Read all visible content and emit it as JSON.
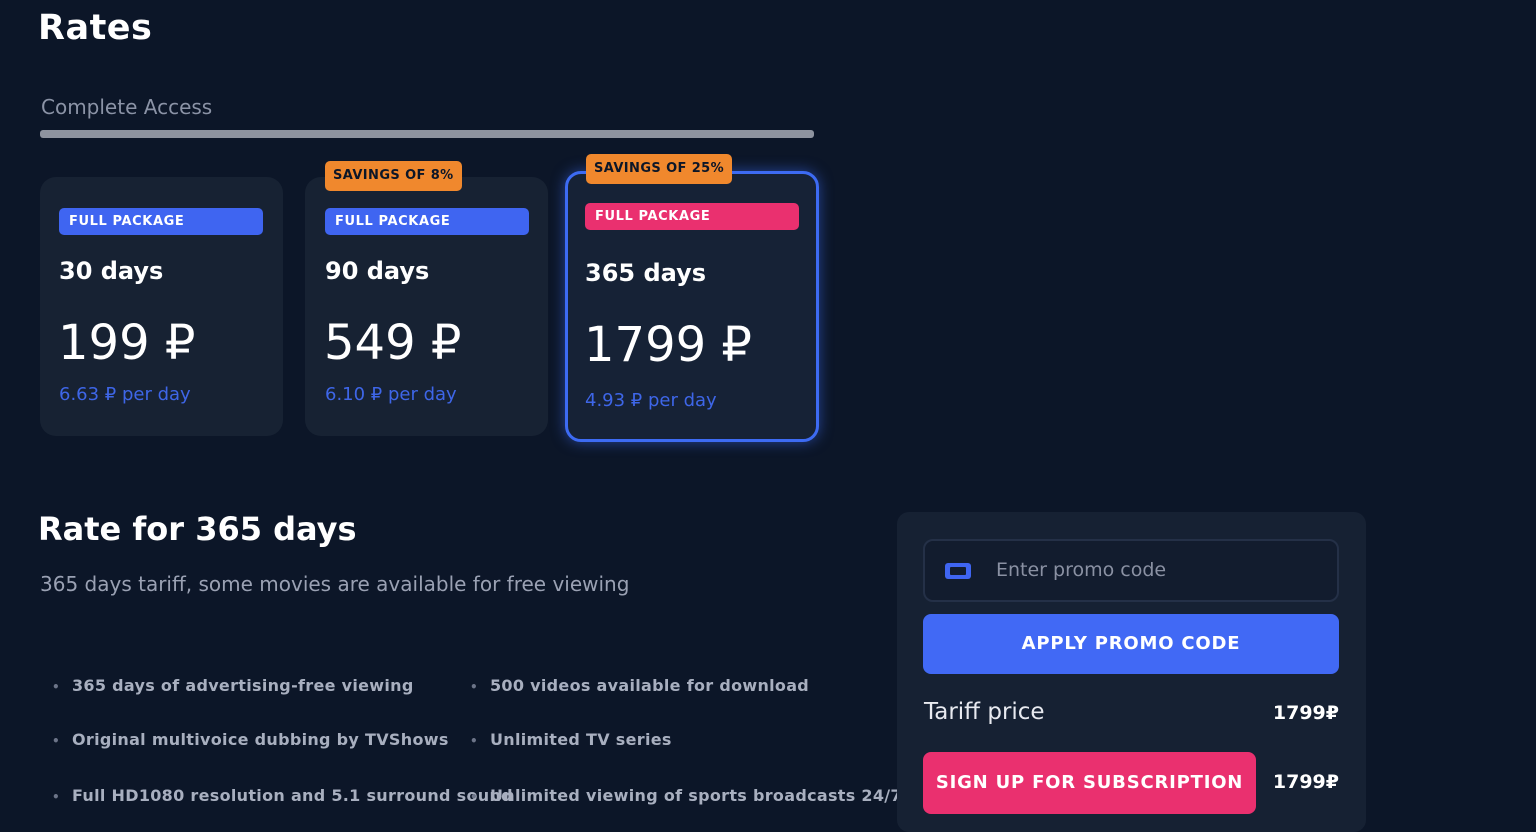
{
  "page": {
    "title": "Rates"
  },
  "tabs": [
    {
      "label": "Complete Access",
      "active": true
    }
  ],
  "plans": [
    {
      "badge": "FULL PACKAGE",
      "duration": "30 days",
      "price": "199 ₽",
      "per_day": "6.63 ₽ per day",
      "savings": null,
      "selected": false
    },
    {
      "badge": "FULL PACKAGE",
      "duration": "90 days",
      "price": "549 ₽",
      "per_day": "6.10 ₽ per day",
      "savings": "SAVINGS OF 8%",
      "selected": false
    },
    {
      "badge": "FULL PACKAGE",
      "duration": "365 days",
      "price": "1799 ₽",
      "per_day": "4.93 ₽ per day",
      "savings": "SAVINGS OF 25%",
      "selected": true
    }
  ],
  "details": {
    "title": "Rate for 365 days",
    "subtitle": "365 days tariff, some movies are available for free viewing",
    "features": [
      "365 days of advertising-free viewing",
      "500 videos available for download",
      "Original multivoice dubbing by TVShows",
      "Unlimited TV series",
      "Full HD1080 resolution and 5.1 surround sound",
      "Unlimited viewing of sports broadcasts 24/7"
    ]
  },
  "promo": {
    "placeholder": "Enter promo code",
    "icon": "ticket-icon",
    "apply_label": "APPLY PROMO CODE",
    "tariff_label": "Tariff price",
    "tariff_value": "1799₽",
    "signup_label": "SIGN UP FOR SUBSCRIPTION",
    "signup_price": "1799₽"
  },
  "colors": {
    "background": "#0c1628",
    "card": "#172233",
    "accent_blue": "#4169f5",
    "accent_pink": "#ea306f",
    "savings_orange": "#f0882d"
  }
}
